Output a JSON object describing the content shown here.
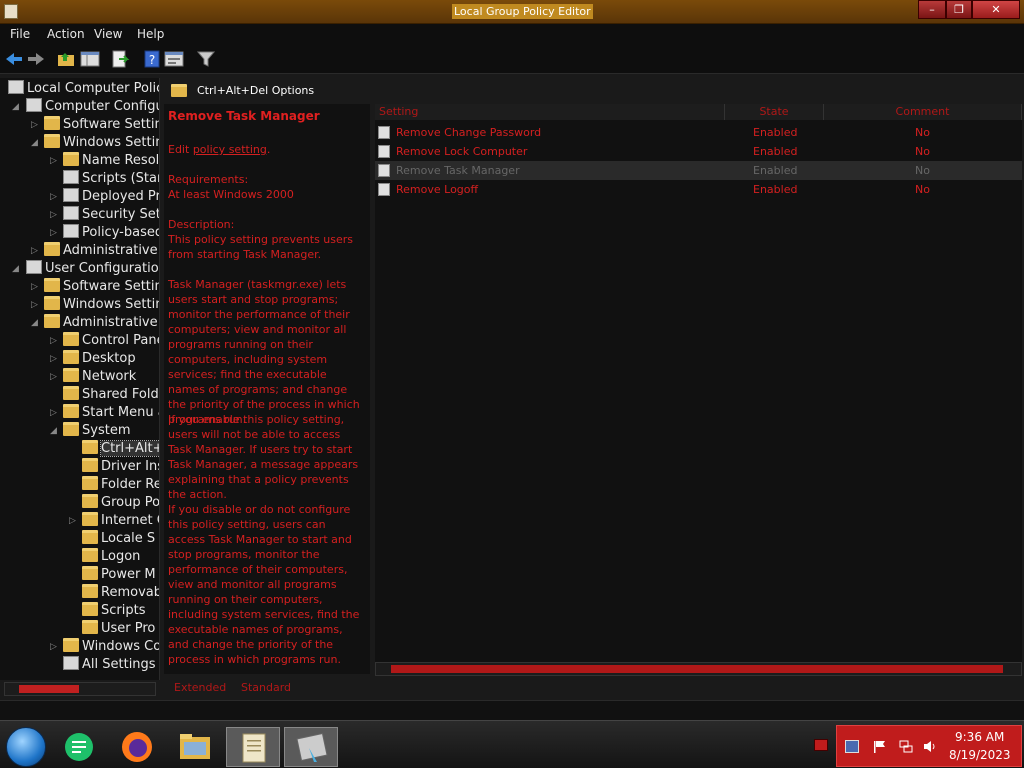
{
  "window": {
    "title": "Local Group Policy Editor",
    "min_label": "–",
    "max_label": "❐",
    "close_label": "✕"
  },
  "menu": [
    "File",
    "Action",
    "View",
    "Help"
  ],
  "tree": [
    {
      "label": "Local Computer Policy",
      "icon": "computer-icon"
    },
    {
      "label": "Computer Configura",
      "icon": "computer-icon"
    },
    {
      "label": "Software Settin",
      "icon": "folder-icon"
    },
    {
      "label": "Windows Settin",
      "icon": "folder-icon"
    },
    {
      "label": "Name Resol",
      "icon": "folder-icon"
    },
    {
      "label": "Scripts (Star",
      "icon": "script-icon"
    },
    {
      "label": "Deployed Pr",
      "icon": "printer-icon"
    },
    {
      "label": "Security Set",
      "icon": "security-icon"
    },
    {
      "label": "Policy-based",
      "icon": "chart-icon"
    },
    {
      "label": "Administrative T",
      "icon": "folder-icon"
    },
    {
      "label": "User Configuration",
      "icon": "user-icon"
    },
    {
      "label": "Software Settin",
      "icon": "folder-icon"
    },
    {
      "label": "Windows Settin",
      "icon": "folder-icon"
    },
    {
      "label": "Administrative T",
      "icon": "folder-icon"
    },
    {
      "label": "Control Pane",
      "icon": "folder-icon"
    },
    {
      "label": "Desktop",
      "icon": "folder-icon"
    },
    {
      "label": "Network",
      "icon": "folder-icon"
    },
    {
      "label": "Shared Fold",
      "icon": "folder-icon"
    },
    {
      "label": "Start Menu a",
      "icon": "folder-icon"
    },
    {
      "label": "System",
      "icon": "folder-icon"
    },
    {
      "label": "Ctrl+Alt+",
      "icon": "folder-icon"
    },
    {
      "label": "Driver Ins",
      "icon": "folder-icon"
    },
    {
      "label": "Folder Re",
      "icon": "folder-icon"
    },
    {
      "label": "Group Po",
      "icon": "folder-icon"
    },
    {
      "label": "Internet C",
      "icon": "folder-icon"
    },
    {
      "label": "Locale S",
      "icon": "folder-icon"
    },
    {
      "label": "Logon",
      "icon": "folder-icon"
    },
    {
      "label": "Power M",
      "icon": "folder-icon"
    },
    {
      "label": "Removab",
      "icon": "folder-icon"
    },
    {
      "label": "Scripts",
      "icon": "folder-icon"
    },
    {
      "label": "User Pro",
      "icon": "folder-icon"
    },
    {
      "label": "Windows Co",
      "icon": "folder-icon"
    },
    {
      "label": "All Settings",
      "icon": "settings-icon"
    }
  ],
  "details": {
    "header": "Ctrl+Alt+Del Options",
    "policy_title": "Remove Task Manager",
    "edit_prefix": "Edit ",
    "edit_link": "policy setting",
    "edit_suffix": ".",
    "requirements_label": "Requirements:",
    "requirements_value": "At least Windows 2000",
    "description_label": "Description:",
    "description_p1": "This policy setting prevents users from starting Task Manager.",
    "description_p2": "Task Manager (taskmgr.exe) lets users start and stop programs; monitor the performance of their computers; view and monitor all programs running on their computers, including system services; find the executable names of programs; and change the priority of the process in which programs run.",
    "description_p3": "If you enable this policy setting, users will not be able to access Task Manager. If users try to start Task Manager, a message appears explaining that a policy prevents the action.",
    "description_p4": "If you disable or do not configure this policy setting, users can access Task Manager to  start and stop programs, monitor the performance of their computers, view and monitor all programs running on their computers, including system services, find the executable names of programs, and change the priority of the process in which programs run."
  },
  "list": {
    "columns": [
      "Setting",
      "State",
      "Comment"
    ],
    "rows": [
      {
        "setting": "Remove Change Password",
        "state": "Enabled",
        "comment": "No"
      },
      {
        "setting": "Remove Lock Computer",
        "state": "Enabled",
        "comment": "No"
      },
      {
        "setting": "Remove Task Manager",
        "state": "Enabled",
        "comment": "No"
      },
      {
        "setting": "Remove Logoff",
        "state": "Enabled",
        "comment": "No"
      }
    ]
  },
  "tabs": [
    "Extended",
    "Standard"
  ],
  "taskbar": {
    "time": "9:36 AM",
    "date": "8/19/2023"
  },
  "colors": {
    "accent_red": "#d42020",
    "title_bar": "#7a4a0a",
    "tray": "#c01c1c"
  }
}
